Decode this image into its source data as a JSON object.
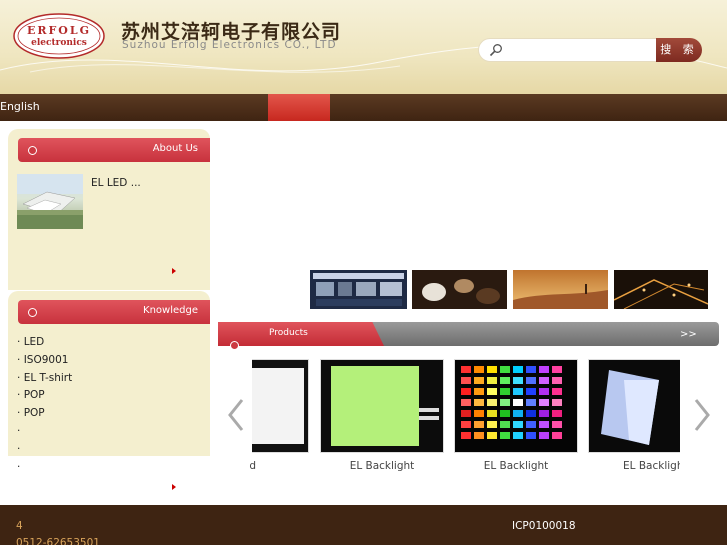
{
  "header": {
    "logo_line1": "ERFOLG",
    "logo_line2": "electronics",
    "company_cn": "苏州艾涪轲电子有限公司",
    "company_en": "Suzhou Erfolg Electronics CO., LTD",
    "search_value": "",
    "search_button": "搜 索"
  },
  "nav": {
    "lang_prefix": "",
    "lang_highlight": "",
    "lang_english": "English",
    "items": [
      {
        "label": ""
      },
      {
        "label": ""
      },
      {
        "label": ""
      },
      {
        "label": ""
      },
      {
        "label": ""
      },
      {
        "label": ""
      },
      {
        "label": ""
      }
    ]
  },
  "about": {
    "title": "",
    "title_en": "About Us",
    "text": "",
    "text_el": "EL",
    "text_led": "LED",
    "ellipsis": "...",
    "more": ""
  },
  "knowledge": {
    "title": "",
    "title_en": "Knowledge",
    "items": [
      "LED",
      "ISO9001",
      "EL T-shirt ",
      "POP",
      "POP",
      "",
      "",
      ""
    ],
    "more": ""
  },
  "products": {
    "title": "",
    "title_en": "Products",
    "more": ">>",
    "captions": [
      "d",
      "EL Backlight",
      "EL Backlight",
      "EL Backligh"
    ]
  },
  "footer": {
    "address": "4",
    "phone": "0512-62653501 ",
    "icp": "ICP0100018",
    "link": ""
  },
  "colors": {
    "accent_red": "#c8323d",
    "nav_brown": "#4a2c18",
    "footer_text": "#d8a35a",
    "highlight_yellow": "#ffe100"
  }
}
